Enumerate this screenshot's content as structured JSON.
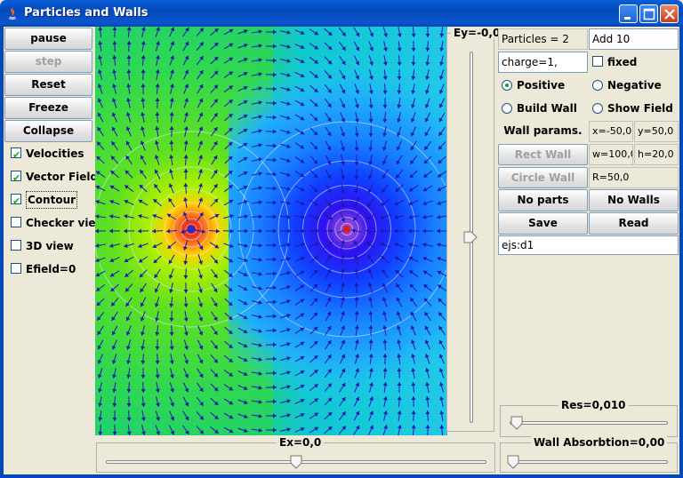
{
  "window": {
    "title": "Particles and Walls"
  },
  "left_buttons": [
    {
      "label": "pause",
      "enabled": true
    },
    {
      "label": "step",
      "enabled": false
    },
    {
      "label": "Reset",
      "enabled": true
    },
    {
      "label": "Freeze",
      "enabled": true
    },
    {
      "label": "Collapse",
      "enabled": true
    }
  ],
  "checkboxes": [
    {
      "label": "Velocities",
      "checked": true
    },
    {
      "label": "Vector Field",
      "checked": true
    },
    {
      "label": "Contour",
      "checked": true
    },
    {
      "label": "Checker view",
      "checked": false
    },
    {
      "label": "3D view",
      "checked": false
    },
    {
      "label": "Efield=0",
      "checked": false
    }
  ],
  "right_panel": {
    "particles_label": "Particles = 2",
    "add_field": "Add 10",
    "charge_field": "charge=1,",
    "fixed_label": "fixed",
    "fixed_checked": false,
    "radios": [
      {
        "label": "Positive",
        "selected": true
      },
      {
        "label": "Negative",
        "selected": false
      },
      {
        "label": "Build Wall",
        "selected": false
      },
      {
        "label": "Show Field",
        "selected": false
      }
    ],
    "wall_params_label": "Wall params.",
    "x_field": "x=-50,0",
    "y_field": "y=50,0",
    "rect_wall_label": "Rect Wall",
    "w_field": "w=100,0",
    "h_field": "h=20,0",
    "circle_wall_label": "Circle Wall",
    "r_field": "R=50,0",
    "no_parts_label": "No parts",
    "no_walls_label": "No Walls",
    "save_label": "Save",
    "read_label": "Read",
    "command_field": "ejs:d1"
  },
  "sliders": {
    "ey": {
      "label": "Ey=-0,0",
      "value": 0.5
    },
    "ex": {
      "label": "Ex=0,0",
      "value": 0.5
    },
    "res": {
      "label": "Res=0,010",
      "value": 0.02
    },
    "absorption": {
      "label": "Wall Absorbtion=0,00",
      "value": 0.0
    }
  },
  "simulation": {
    "positive_particle_color": "#1f2fd0",
    "negative_particle_color": "#d21f1f"
  }
}
